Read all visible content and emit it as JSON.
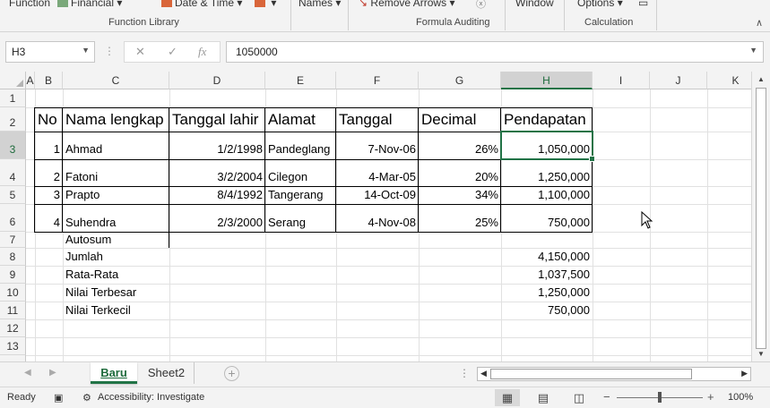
{
  "ribbon": {
    "top_items": [
      "Function",
      "Financial",
      "Date & Time",
      "Names",
      "Remove Arrows",
      "Window",
      "Options"
    ],
    "groups": [
      "Function Library",
      "Formula Auditing",
      "Calculation"
    ]
  },
  "formula_bar": {
    "name_box": "H3",
    "cancel_symbol": "✕",
    "enter_symbol": "✓",
    "fx_label": "fx",
    "value": "1050000"
  },
  "columns": [
    "A",
    "B",
    "C",
    "D",
    "E",
    "F",
    "G",
    "H",
    "I",
    "J",
    "K"
  ],
  "rows": [
    "1",
    "2",
    "3",
    "4",
    "5",
    "6",
    "7",
    "8",
    "9",
    "10",
    "11",
    "12",
    "13"
  ],
  "table": {
    "headers": [
      "No",
      "Nama lengkap",
      "Tanggal lahir",
      "Alamat",
      "Tanggal",
      "Decimal",
      "Pendapatan"
    ],
    "rows": [
      {
        "no": "1",
        "nama": "Ahmad",
        "lahir": "1/2/1998",
        "alamat": "Pandeglang",
        "tanggal": "7-Nov-06",
        "decimal": "26%",
        "pendapatan": "1,050,000"
      },
      {
        "no": "2",
        "nama": "Fatoni",
        "lahir": "3/2/2004",
        "alamat": "Cilegon",
        "tanggal": "4-Mar-05",
        "decimal": "20%",
        "pendapatan": "1,250,000"
      },
      {
        "no": "3",
        "nama": "Prapto",
        "lahir": "8/4/1992",
        "alamat": "Tangerang",
        "tanggal": "14-Oct-09",
        "decimal": "34%",
        "pendapatan": "1,100,000"
      },
      {
        "no": "4",
        "nama": "Suhendra",
        "lahir": "2/3/2000",
        "alamat": "Serang",
        "tanggal": "4-Nov-08",
        "decimal": "25%",
        "pendapatan": "750,000"
      }
    ]
  },
  "summary": {
    "title": "Autosum",
    "items": [
      {
        "label": "Jumlah",
        "value": "4,150,000"
      },
      {
        "label": "Rata-Rata",
        "value": "1,037,500"
      },
      {
        "label": "Nilai Terbesar",
        "value": "1,250,000"
      },
      {
        "label": "Nilai Terkecil",
        "value": "750,000"
      }
    ]
  },
  "sheets": {
    "tabs": [
      "Baru",
      "Sheet2"
    ],
    "active": "Baru"
  },
  "status": {
    "ready": "Ready",
    "accessibility": "Accessibility: Investigate",
    "zoom": "100%"
  },
  "colors": {
    "accent": "#217346",
    "grid_line": "#e1e1e1",
    "header_bg": "#f3f3f3"
  }
}
